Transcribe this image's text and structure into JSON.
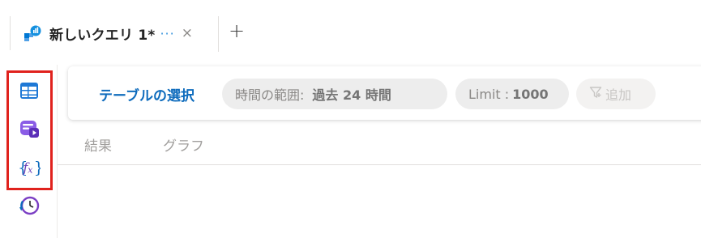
{
  "query_tab": {
    "title": "新しいクエリ 1*",
    "more": "···",
    "close": "×",
    "add": "+"
  },
  "toolbar": {
    "select_table": "テーブルの選択",
    "time_range_label": "時間の範囲:",
    "time_range_value": "過去 24 時間",
    "limit_label": "Limit :",
    "limit_value": "1000",
    "add_filter": "追加"
  },
  "result_tabs": [
    "結果",
    "グラフ"
  ],
  "sidebar_icons": [
    "tables-icon",
    "queries-icon",
    "functions-icon",
    "query-history-icon"
  ],
  "colors": {
    "accent": "#0f6cbd",
    "highlight_border": "#e0221d",
    "pill_bg": "#ededed"
  }
}
